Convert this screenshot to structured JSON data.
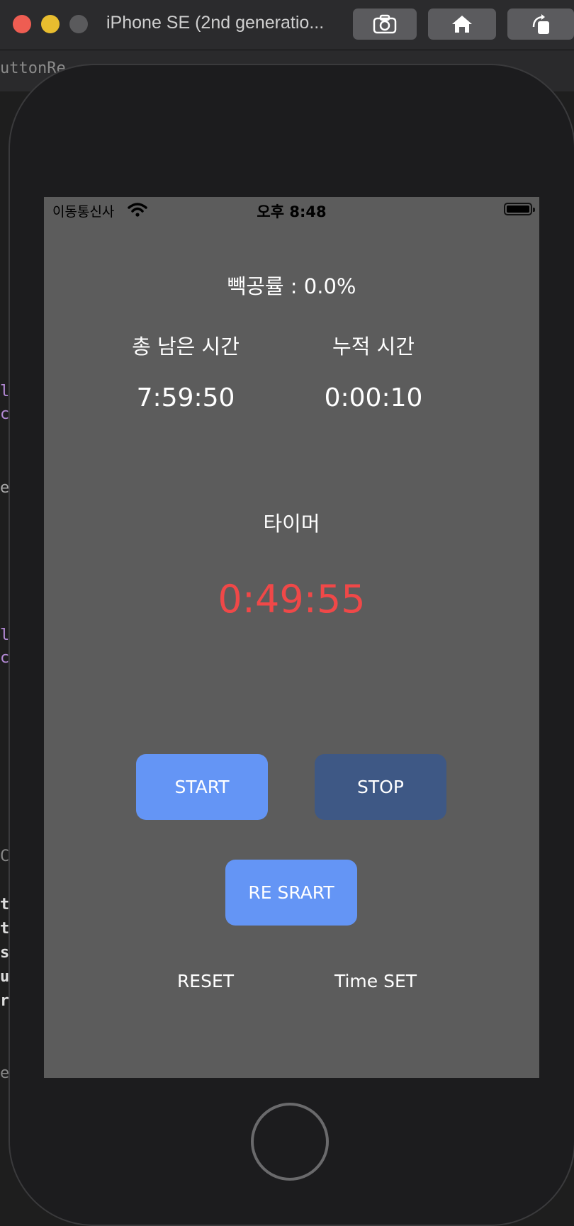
{
  "simulator": {
    "title": "iPhone SE (2nd generatio...",
    "toolbar": [
      "screenshot-icon",
      "home-icon",
      "rotate-icon"
    ]
  },
  "editor": {
    "tab_fragment": "uttonRe",
    "code_fragments": [
      "l",
      "c",
      "e",
      "l",
      "c",
      "Cc",
      "t",
      "ta",
      "s",
      "u",
      "r",
      "e"
    ]
  },
  "status_bar": {
    "carrier": "이동통신사",
    "time": "오후 8:48"
  },
  "app": {
    "completion_rate": "빽공률 : 0.0%",
    "remaining_label": "총 남은 시간",
    "accumulated_label": "누적 시간",
    "remaining_value": "7:59:50",
    "accumulated_value": "0:00:10",
    "timer_label": "타이머",
    "timer_value": "0:49:55",
    "start_label": "START",
    "stop_label": "STOP",
    "restart_label": "RE SRART",
    "reset_label": "RESET",
    "timeset_label": "Time SET"
  },
  "colors": {
    "screen_bg": "#5c5c5c",
    "timer_red": "#f04848",
    "button_blue": "#6495f5",
    "button_dark_blue": "#3e5885"
  }
}
